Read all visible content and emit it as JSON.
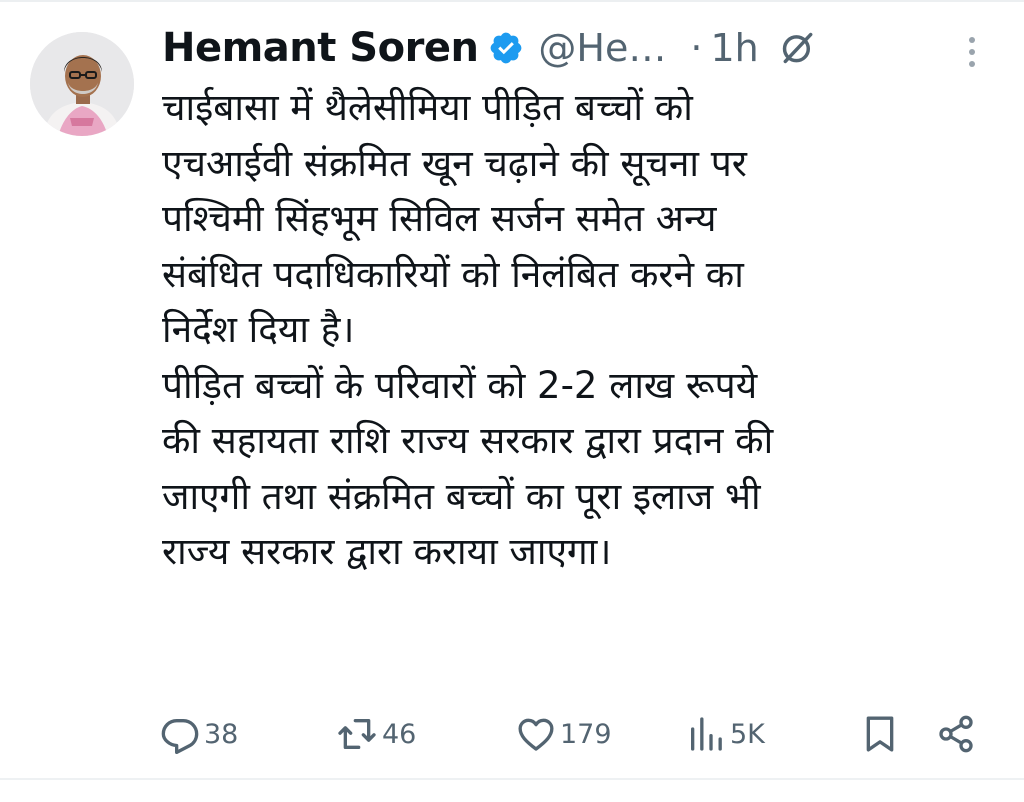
{
  "tweet": {
    "author_name": "Hemant Soren",
    "author_handle": "@He…",
    "separator": "·",
    "time": "1h",
    "text_lines": [
      "चाईबासा में थैलेसीमिया पीड़ित बच्चों को",
      "एचआईवी संक्रमित खून चढ़ाने की सूचना पर",
      "पश्चिमी सिंहभूम सिविल सर्जन समेत अन्य",
      "संबंधित पदाधिकारियों को निलंबित करने का",
      "निर्देश दिया है।",
      "पीड़ित बच्चों के परिवारों को 2-2 लाख रूपये",
      "की सहायता राशि राज्य सरकार द्वारा प्रदान की",
      "जाएगी तथा संक्रमित बच्चों का पूरा इलाज भी",
      "राज्य सरकार द्वारा कराया जाएगा।"
    ],
    "actions": {
      "replies": "38",
      "reposts": "46",
      "likes": "179",
      "views": "5K"
    }
  },
  "icons": {
    "verified": "verified-badge-icon",
    "grok": "grok-icon",
    "more": "more-options-icon",
    "reply": "reply-icon",
    "repost": "repost-icon",
    "like": "heart-icon",
    "views": "views-chart-icon",
    "bookmark": "bookmark-icon",
    "share": "share-icon"
  },
  "colors": {
    "text": "#0f1419",
    "secondary": "#536471",
    "verified": "#1d9bf0"
  }
}
